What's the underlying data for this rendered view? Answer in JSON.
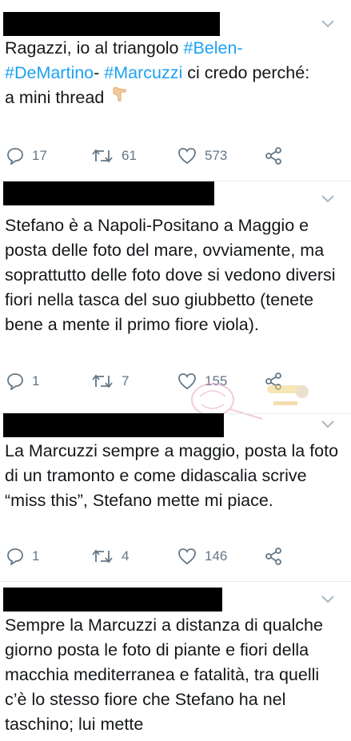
{
  "tweets": [
    {
      "text_parts": [
        "Ragazzi, io al triangolo ",
        "#Belen-",
        " ",
        "#DeMartino",
        "- ",
        "#Marcuzzi",
        " ci credo perché:",
        "a mini thread"
      ],
      "replies": "17",
      "retweets": "61",
      "likes": "573"
    },
    {
      "text": "Stefano è a Napoli-Positano a Maggio e posta delle foto del mare, ovviamente, ma soprattutto delle foto dove si vedono diversi fiori nella tasca del suo giubbetto (tenete bene a mente il primo fiore viola).",
      "replies": "1",
      "retweets": "7",
      "likes": "155"
    },
    {
      "text": "La Marcuzzi sempre a maggio, posta la foto di un tramonto e come didascalia scrive “miss this”, Stefano mette mi piace.",
      "replies": "1",
      "retweets": "4",
      "likes": "146"
    },
    {
      "text": "Sempre la Marcuzzi a distanza di qualche giorno posta le foto di piante e fiori della macchia mediterranea e fatalità, tra quelli c’è lo stesso fiore che Stefano ha nel taschino; lui mette"
    }
  ],
  "colors": {
    "accent": "#1da1f2",
    "muted": "#657786",
    "redaction": "#000000",
    "divider": "#e6ecf0"
  },
  "icons": [
    "reply-icon",
    "retweet-icon",
    "like-icon",
    "share-icon",
    "chevron-down-icon",
    "pointing-hand-emoji"
  ]
}
